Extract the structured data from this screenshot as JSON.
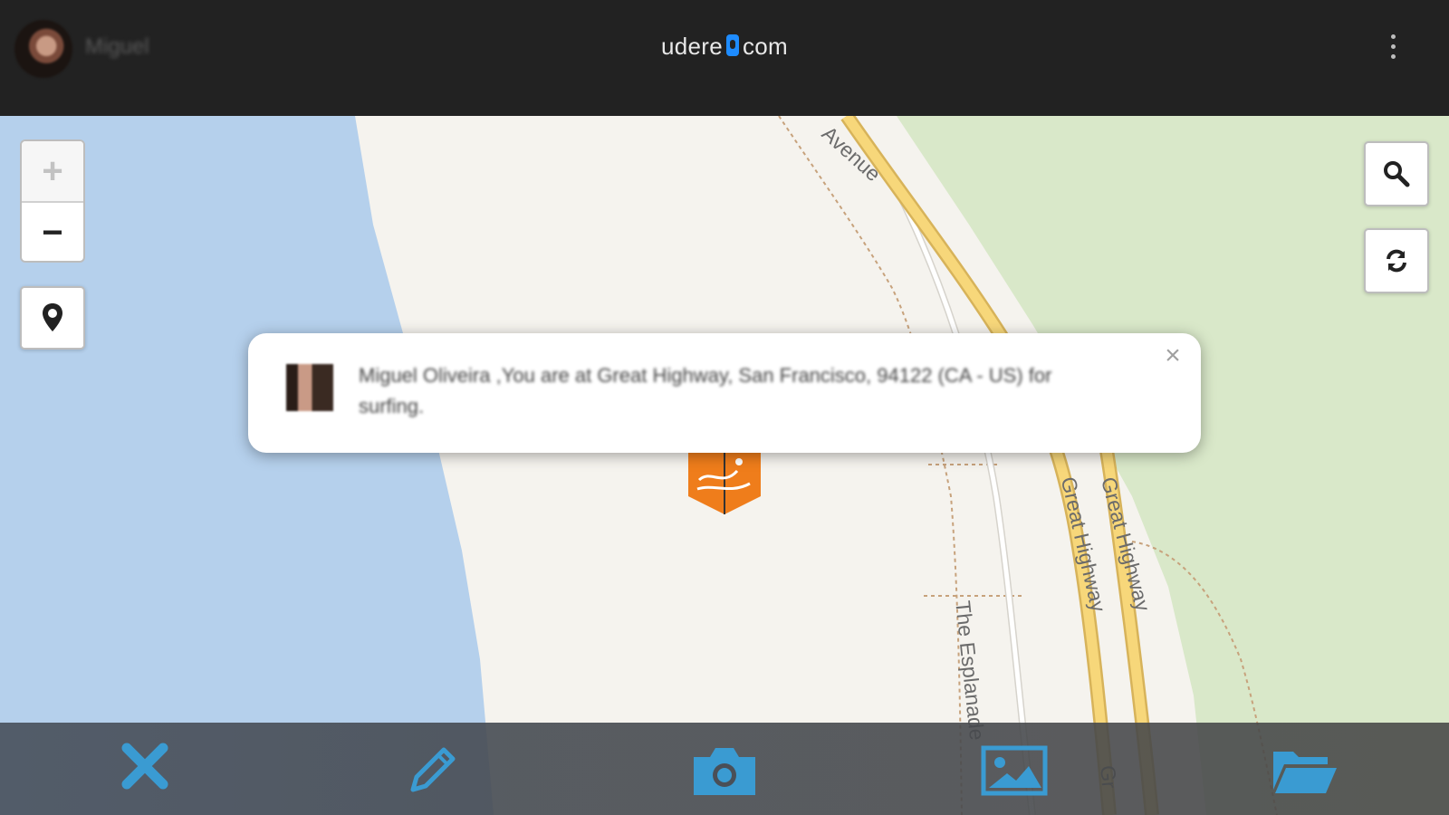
{
  "header": {
    "user_name": "Miguel",
    "brand_left": "udere",
    "brand_right": "com"
  },
  "map": {
    "road_labels": {
      "avenue": "Avenue",
      "great_highway_1": "Great Highway",
      "great_highway_2": "Great Highway",
      "esplanade": "The Esplanade",
      "great_highway_cut": "Gr"
    },
    "controls": {
      "zoom_in": "+",
      "zoom_out": "−"
    }
  },
  "popup": {
    "message": "Miguel Oliveira ,You are at Great Highway, San Francisco, 94122 (CA - US) for surfing.",
    "close": "×"
  },
  "toolbar": {
    "items": [
      "close-icon",
      "pencil-icon",
      "camera-icon",
      "image-icon",
      "folder-open-icon"
    ]
  },
  "colors": {
    "header_bg": "#222222",
    "water": "#b5d0ec",
    "land": "#f5f3ee",
    "park": "#d9e8c9",
    "highway": "#f7d77a",
    "marker": "#ef7d1b",
    "toolbar_icon": "#3a9bd2",
    "brand_accent": "#1e8cff"
  }
}
